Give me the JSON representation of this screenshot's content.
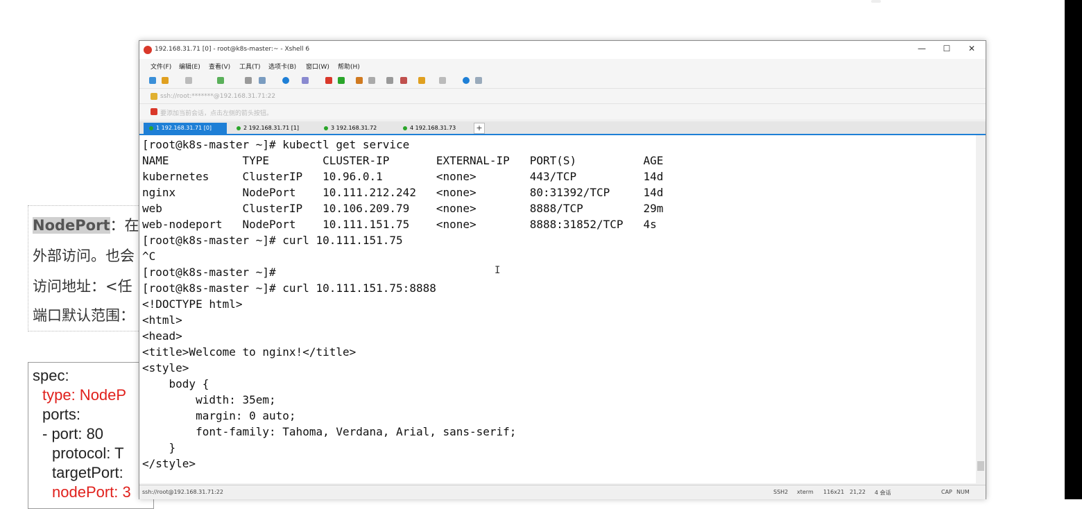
{
  "slide": {
    "lines": [
      {
        "highlight": "NodePort",
        "rest": "：在"
      },
      {
        "text": "外部访问。也会"
      },
      {
        "text": "访问地址：<任"
      },
      {
        "text": "端口默认范围："
      }
    ],
    "code": [
      {
        "text": "spec:",
        "color": "dark"
      },
      {
        "text": "type: NodeP",
        "color": "red"
      },
      {
        "text": "ports:",
        "color": "dark"
      },
      {
        "text": "- port: 80",
        "color": "dark"
      },
      {
        "text": "protocol: T",
        "color": "dark"
      },
      {
        "text": "targetPort:",
        "color": "dark"
      },
      {
        "text": "nodePort: 3",
        "color": "red"
      }
    ]
  },
  "window": {
    "title": "192.168.31.71 [0] - root@k8s-master:~ - Xshell 6",
    "controls": {
      "minimize": "—",
      "maximize": "☐",
      "close": "✕"
    },
    "menu": [
      "文件(F)",
      "编辑(E)",
      "查看(V)",
      "工具(T)",
      "选项卡(B)",
      "窗口(W)",
      "帮助(H)"
    ],
    "address": "ssh://root:*******@192.168.31.71:22",
    "hint": "要添加当前会话，点击左侧的箭头按钮。",
    "tabs": [
      {
        "label": "1 192.168.31.71 [0]",
        "active": true
      },
      {
        "label": "2 192.168.31.71 [1]",
        "active": false
      },
      {
        "label": "3 192.168.31.72",
        "active": false
      },
      {
        "label": "4 192.168.31.73",
        "active": false
      }
    ],
    "tab_add": "+"
  },
  "terminal": {
    "lines": [
      "[root@k8s-master ~]# kubectl get service",
      "NAME           TYPE        CLUSTER-IP       EXTERNAL-IP   PORT(S)          AGE",
      "kubernetes     ClusterIP   10.96.0.1        <none>        443/TCP          14d",
      "nginx          NodePort    10.111.212.242   <none>        80:31392/TCP     14d",
      "web            ClusterIP   10.106.209.79    <none>        8888/TCP         29m",
      "web-nodeport   NodePort    10.111.151.75    <none>        8888:31852/TCP   4s",
      "[root@k8s-master ~]# curl 10.111.151.75",
      "^C",
      "[root@k8s-master ~]#",
      "[root@k8s-master ~]# curl 10.111.151.75:8888",
      "<!DOCTYPE html>",
      "<html>",
      "<head>",
      "<title>Welcome to nginx!</title>",
      "<style>",
      "    body {",
      "        width: 35em;",
      "        margin: 0 auto;",
      "        font-family: Tahoma, Verdana, Arial, sans-serif;",
      "    }",
      "</style>"
    ]
  },
  "statusbar": {
    "connection": "ssh://root@192.168.31.71:22",
    "protocol": "SSH2",
    "term": "xterm",
    "size": "116x21",
    "cursor": "21,22",
    "sessions": "4 会话",
    "caps": "CAP",
    "num": "NUM"
  }
}
